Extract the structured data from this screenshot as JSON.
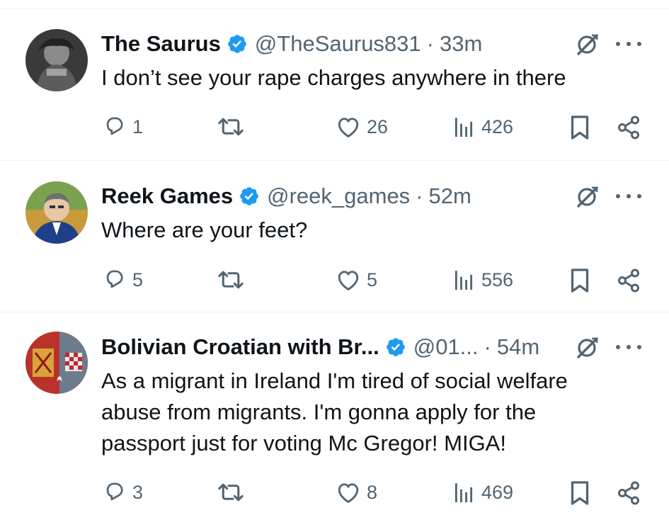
{
  "tweets": [
    {
      "name": "The Saurus",
      "handle": "@TheSaurus831",
      "separator": "·",
      "time": "33m",
      "text": "I don’t see your rape charges anywhere in there",
      "replies": "1",
      "likes": "26",
      "views": "426"
    },
    {
      "name": "Reek Games",
      "handle": "@reek_games",
      "separator": "·",
      "time": "52m",
      "text": "Where are your feet?",
      "replies": "5",
      "likes": "5",
      "views": "556"
    },
    {
      "name": "Bolivian Croatian with Br...",
      "handle": "@01...",
      "separator": "·",
      "time": "54m",
      "text": "As a migrant in Ireland I'm tired of social welfare\nabuse from migrants. I'm gonna apply for the\npassport just for voting Mc Gregor! MIGA!",
      "replies": "3",
      "likes": "8",
      "views": "469"
    }
  ],
  "icons": {
    "verified": "verified-badge-icon",
    "grok": "grok-icon",
    "more": "more-icon",
    "reply": "reply-icon",
    "retweet": "retweet-icon",
    "like": "like-icon",
    "views": "views-icon",
    "bookmark": "bookmark-icon",
    "share": "share-icon"
  },
  "colors": {
    "verified": "#1d9bf0",
    "text": "#0f1419",
    "secondary": "#536471",
    "divider": "#eff3f4"
  }
}
